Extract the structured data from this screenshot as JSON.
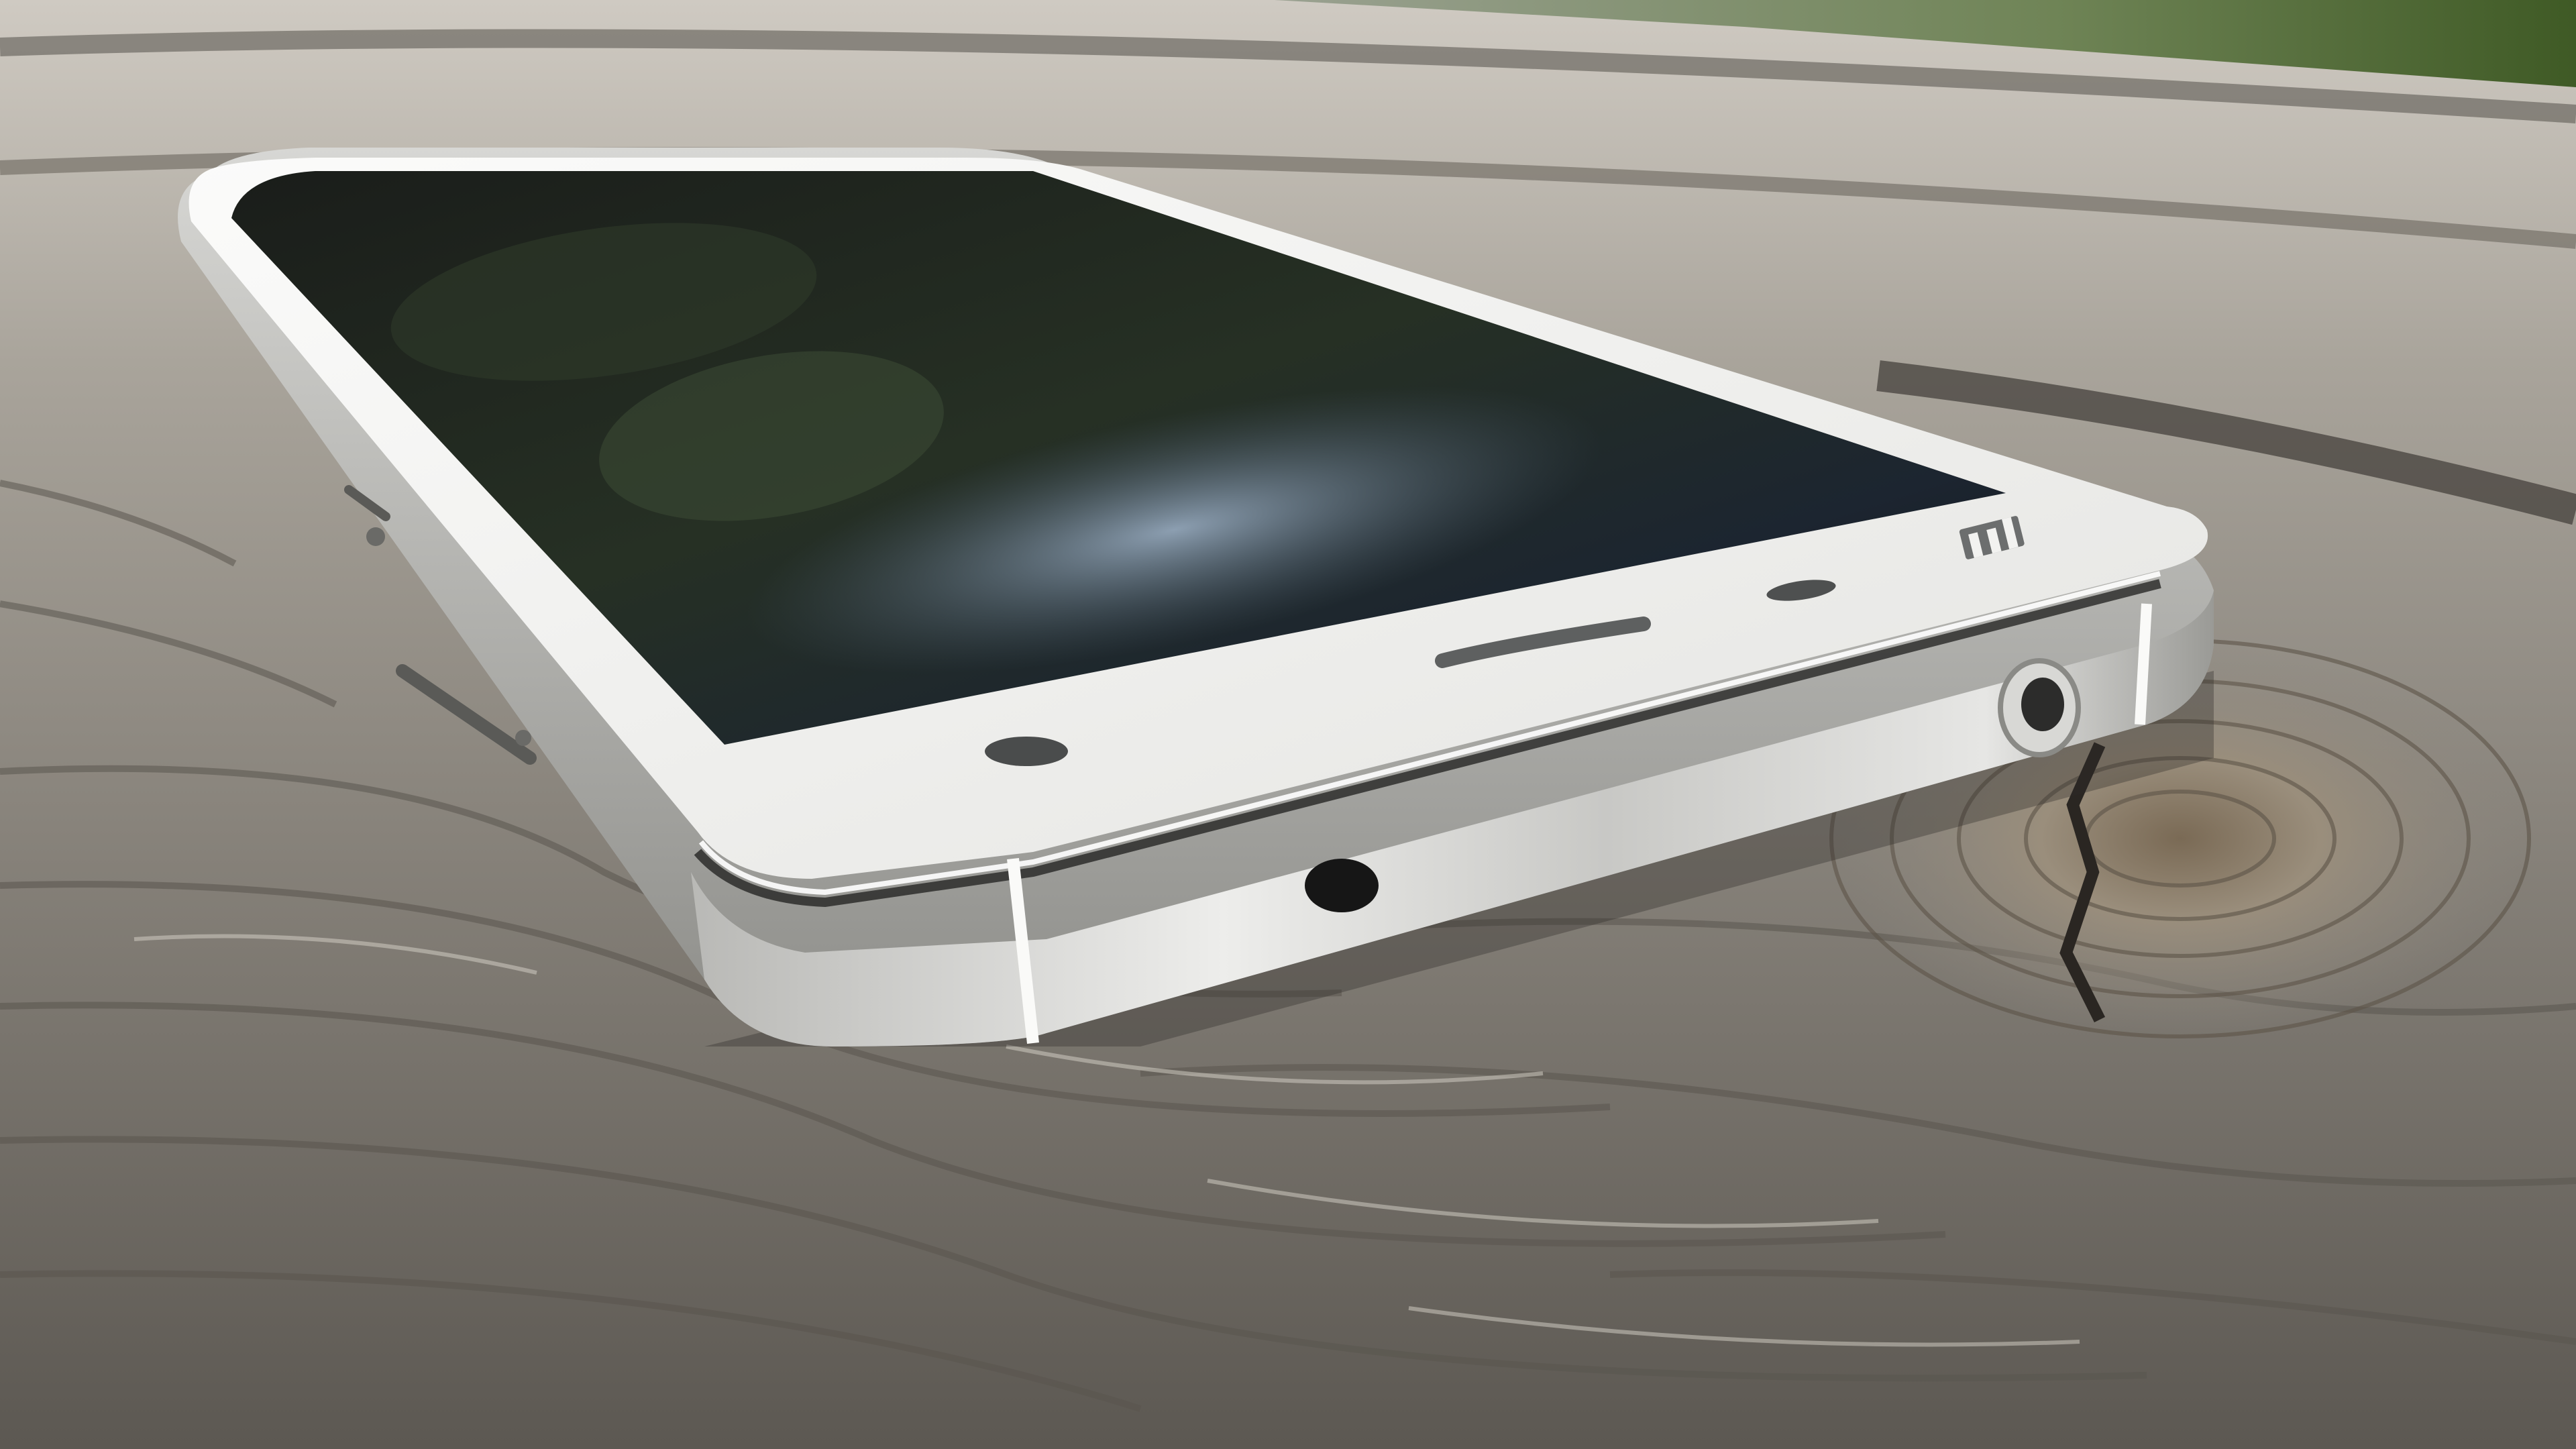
{
  "scene": {
    "subject": "phone",
    "logo_text": "MI",
    "colors": {
      "wood_light": "#b9b4aa",
      "wood_mid": "#8f8a82",
      "wood_dark": "#4e4a45",
      "grass": "#4f6b33",
      "glass_front": "#f2f2f0",
      "screen": "#121412",
      "metal_light": "#ededeb",
      "metal_dark": "#8d8d89"
    }
  }
}
